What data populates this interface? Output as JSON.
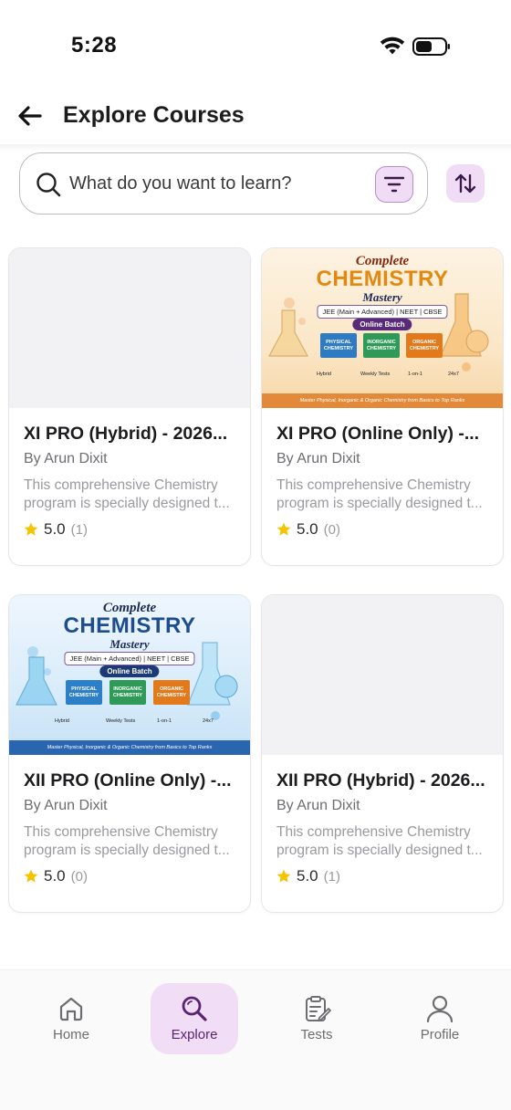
{
  "status_bar": {
    "time": "5:28"
  },
  "header": {
    "title": "Explore Courses"
  },
  "search": {
    "placeholder": "What do you want to learn?"
  },
  "courses": [
    {
      "title": "XI PRO (Hybrid) - 2026...",
      "author": "By Arun Dixit",
      "description_line1": "This comprehensive Chemistry",
      "description_line2": "program is specially designed t...",
      "rating": "5.0",
      "rating_count": "(1)",
      "has_image": false
    },
    {
      "title": "XI PRO (Online Only) -...",
      "author": "By Arun Dixit",
      "description_line1": "This comprehensive Chemistry",
      "description_line2": "program is specially designed t...",
      "rating": "5.0",
      "rating_count": "(0)",
      "has_image": true,
      "banner_theme": "warm"
    },
    {
      "title": "XII PRO (Online Only) -...",
      "author": "By Arun Dixit",
      "description_line1": "This comprehensive Chemistry",
      "description_line2": "program is specially designed t...",
      "rating": "5.0",
      "rating_count": "(0)",
      "has_image": true,
      "banner_theme": "cool"
    },
    {
      "title": "XII PRO (Hybrid) - 2026...",
      "author": "By Arun Dixit",
      "description_line1": "This comprehensive Chemistry",
      "description_line2": "program is specially designed t...",
      "rating": "5.0",
      "rating_count": "(1)",
      "has_image": false
    }
  ],
  "banner": {
    "complete": "Complete",
    "chemistry": "CHEMISTRY",
    "mastery": "Mastery",
    "exams": "JEE (Main + Advanced) | NEET | CBSE",
    "batch": "Online Batch",
    "books": [
      "PHYSICAL CHEMISTRY",
      "INORGANIC CHEMISTRY",
      "ORGANIC CHEMISTRY"
    ],
    "features": [
      "Hybrid",
      "Weekly Tests",
      "1-on-1",
      "24x7"
    ],
    "footer": "Master Physical, Inorganic & Organic Chemistry from Basics to Top Ranks"
  },
  "bottom_nav": {
    "items": [
      {
        "label": "Home",
        "icon": "home-icon",
        "active": false
      },
      {
        "label": "Explore",
        "icon": "explore-search-icon",
        "active": true
      },
      {
        "label": "Tests",
        "icon": "tests-clipboard-icon",
        "active": false
      },
      {
        "label": "Profile",
        "icon": "profile-person-icon",
        "active": false
      }
    ]
  },
  "colors": {
    "accent": "#5a2470",
    "accent_bg": "#f1ddf5",
    "star": "#f5c400"
  }
}
